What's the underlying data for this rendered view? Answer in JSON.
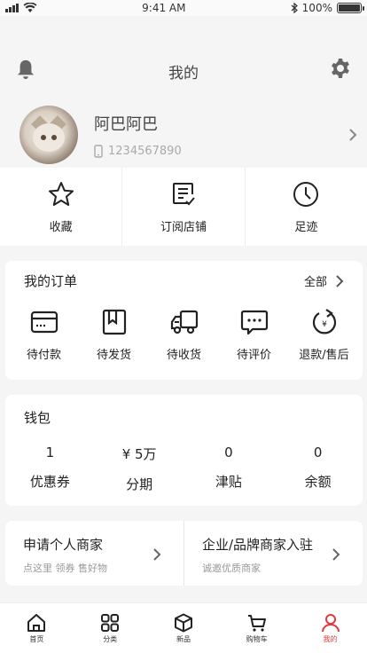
{
  "status_bar": {
    "time": "9:41 AM",
    "battery": "100%"
  },
  "header": {
    "title": "我的"
  },
  "profile": {
    "name": "阿巴阿巴",
    "phone": "1234567890"
  },
  "quick_links": [
    {
      "label": "收藏",
      "icon": "star-icon"
    },
    {
      "label": "订阅店铺",
      "icon": "subscribe-icon"
    },
    {
      "label": "足迹",
      "icon": "clock-icon"
    }
  ],
  "orders": {
    "title": "我的订单",
    "all_label": "全部",
    "items": [
      {
        "label": "待付款",
        "icon": "wallet-card-icon"
      },
      {
        "label": "待发货",
        "icon": "package-icon"
      },
      {
        "label": "待收货",
        "icon": "truck-icon"
      },
      {
        "label": "待评价",
        "icon": "comment-icon"
      },
      {
        "label": "退款/售后",
        "icon": "refund-icon"
      }
    ]
  },
  "wallet": {
    "title": "钱包",
    "items": [
      {
        "value": "1",
        "label": "优惠券"
      },
      {
        "value": "¥ 5万",
        "label": "分期"
      },
      {
        "value": "0",
        "label": "津贴"
      },
      {
        "value": "0",
        "label": "余额"
      }
    ]
  },
  "merchant": [
    {
      "title": "申请个人商家",
      "subtitle": "点这里 领券 售好物"
    },
    {
      "title": "企业/品牌商家入驻",
      "subtitle": "诚邀优质商家"
    }
  ],
  "tabbar": [
    {
      "label": "首页",
      "icon": "home-icon"
    },
    {
      "label": "分类",
      "icon": "category-icon"
    },
    {
      "label": "新品",
      "icon": "cube-icon"
    },
    {
      "label": "购物车",
      "icon": "cart-icon"
    },
    {
      "label": "我的",
      "icon": "user-icon",
      "active": true
    }
  ],
  "colors": {
    "accent": "#e4393c",
    "background": "#f5f5f5"
  }
}
